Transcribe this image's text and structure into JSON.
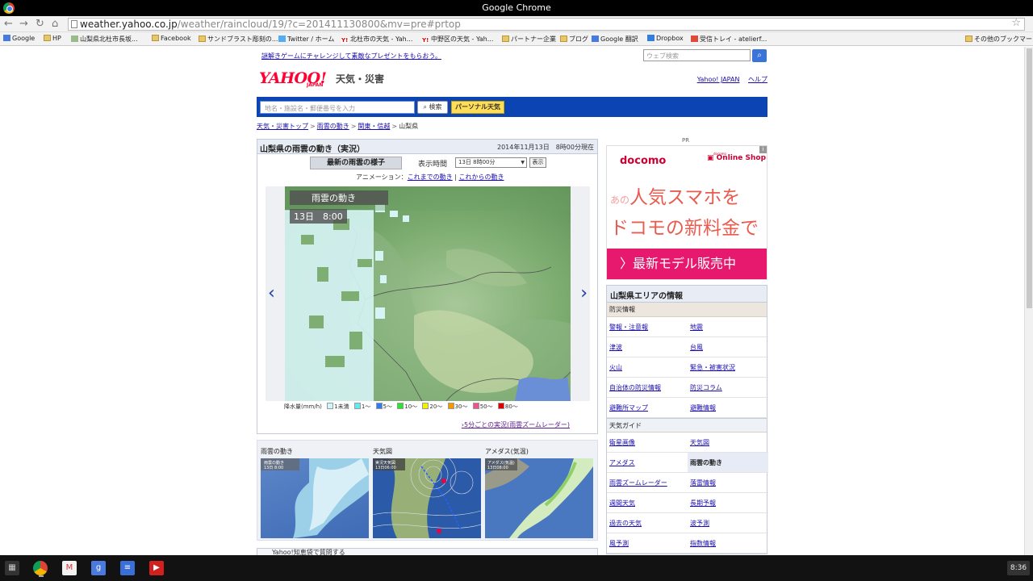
{
  "window": {
    "title": "Google Chrome"
  },
  "address": {
    "host": "weather.yahoo.co.jp",
    "path": "/weather/raincloud/19/?c=201411130800&mv=pre#prtop"
  },
  "bookmarks": [
    {
      "label": "Google",
      "icon": "google-icon"
    },
    {
      "label": "HP",
      "icon": "folder-icon"
    },
    {
      "label": "山梨県北杜市長坂...",
      "icon": "site-icon"
    },
    {
      "label": "Facebook",
      "icon": "folder-icon"
    },
    {
      "label": "サンドブラスト彫刻の...",
      "icon": "folder-icon"
    },
    {
      "label": "Twitter / ホーム",
      "icon": "twitter-icon"
    },
    {
      "label": "北杜市の天気 - Yah...",
      "icon": "yahoo-icon"
    },
    {
      "label": "中野区の天気 - Yah...",
      "icon": "yahoo-icon"
    },
    {
      "label": "パートナー企業",
      "icon": "folder-icon"
    },
    {
      "label": "ブログ",
      "icon": "folder-icon"
    },
    {
      "label": "Google 翻訳",
      "icon": "translate-icon"
    },
    {
      "label": "Dropbox",
      "icon": "dropbox-icon"
    },
    {
      "label": "受信トレイ - atelierf...",
      "icon": "gmail-icon"
    },
    {
      "label": "その他のブックマーク",
      "icon": "folder-icon"
    }
  ],
  "header": {
    "promo": "謎解きゲームにチャレンジして素敵なプレゼントをもらおう。",
    "websearch_placeholder": "ウェブ検索",
    "logo": "YAHOO!",
    "logo_sub": "JAPAN",
    "tag": "天気・災害",
    "links": [
      "Yahoo! JAPAN",
      "ヘルプ"
    ]
  },
  "searchbar": {
    "placeholder": "地名・施設名・郵便番号を入力",
    "search_label": "検索",
    "personal_label": "パーソナル天気"
  },
  "breadcrumb": [
    "天気・災害トップ",
    "雨雲の動き",
    "関東・信越",
    "山梨県"
  ],
  "main": {
    "title": "山梨県の雨雲の動き（実況）",
    "timestamp": "2014年11月13日　8時00分現在",
    "tab": "最新の雨雲の様子",
    "time_label": "表示時間",
    "time_value": "13日 8時00分",
    "show_label": "表示",
    "anim_prefix": "アニメーション：",
    "anim_past": "これまでの動き",
    "anim_sep": "|",
    "anim_future": "これからの動き",
    "map_title": "雨雲の動き",
    "map_time": "13日　8:00",
    "zoom_link": "5分ごとの実況(雨雲ズームレーダー)"
  },
  "legend": {
    "label": "降水量(mm/h)",
    "items": [
      {
        "label": "1未満",
        "color": "#ccf6f8"
      },
      {
        "label": "1～",
        "color": "#66e8ee"
      },
      {
        "label": "5～",
        "color": "#2f7bf0"
      },
      {
        "label": "10～",
        "color": "#2ee52e"
      },
      {
        "label": "20～",
        "color": "#f2f200"
      },
      {
        "label": "30～",
        "color": "#f29a00"
      },
      {
        "label": "50～",
        "color": "#f2508a"
      },
      {
        "label": "80～",
        "color": "#e00000"
      }
    ]
  },
  "thumbs": [
    {
      "caption": "雨雲の動き",
      "sub": "雨雲の動き"
    },
    {
      "caption": "天気図",
      "sub": "実況天気図"
    },
    {
      "caption": "アメダス(気温)",
      "sub": "アメダス(気温)"
    }
  ],
  "thumb_stamps": [
    "13日 8:00",
    "13日06:00",
    "13日08:00"
  ],
  "bottom_stub": "Yahoo!知恵袋で質問する",
  "ad": {
    "pr": "PR",
    "brand": "docomo",
    "shop_small": "docomo",
    "shop": "Online Shop",
    "line1_prefix": "あの",
    "line1": "人気スマホを",
    "line2": "ドコモの新料金で",
    "banner": "〉最新モデル販売中",
    "info": "i"
  },
  "area": {
    "title": "山梨県エリアの情報",
    "disaster_head": "防災情報",
    "disaster": [
      "警報・注意報",
      "地震",
      "津波",
      "台風",
      "火山",
      "緊急・被害状況",
      "自治体の防災情報",
      "防災コラム",
      "避難所マップ",
      "避難情報"
    ],
    "guide_head": "天気ガイド",
    "guide": [
      "衛星画像",
      "天気図",
      "アメダス",
      "雨雲の動き",
      "雨雲ズームレーダー",
      "落雷情報",
      "週間天気",
      "長期予報",
      "過去の天気",
      "波予測",
      "風予測",
      "指数情報"
    ],
    "current": "雨雲の動き"
  },
  "taskbar": {
    "clock": "8:36"
  },
  "colors": {
    "accent": "#0d44b4",
    "yahoo_red": "#ff0033",
    "ad_pink": "#e6196e"
  }
}
